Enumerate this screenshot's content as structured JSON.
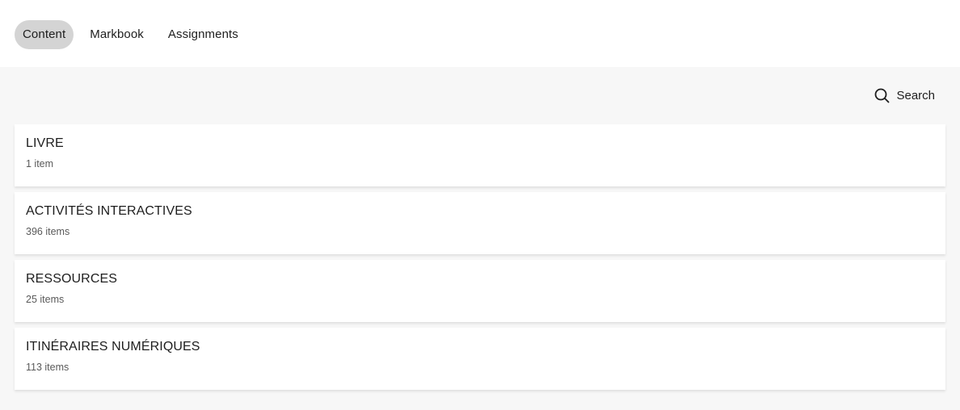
{
  "nav": {
    "tabs": [
      {
        "label": "Content",
        "active": true
      },
      {
        "label": "Markbook",
        "active": false
      },
      {
        "label": "Assignments",
        "active": false
      }
    ]
  },
  "toolbar": {
    "search_label": "Search",
    "search_icon": "search-icon"
  },
  "sections": [
    {
      "title": "LIVRE",
      "count": "1 item"
    },
    {
      "title": "ACTIVITÉS INTERACTIVES",
      "count": "396 items"
    },
    {
      "title": "RESSOURCES",
      "count": "25 items"
    },
    {
      "title": "ITINÉRAIRES NUMÉRIQUES",
      "count": "113 items"
    }
  ],
  "colors": {
    "active_tab_bg": "#d4d4d4",
    "page_bg": "#f7f7f7",
    "card_bg": "#ffffff",
    "text": "#1e1e1e",
    "muted_text": "#5a5a5a"
  }
}
